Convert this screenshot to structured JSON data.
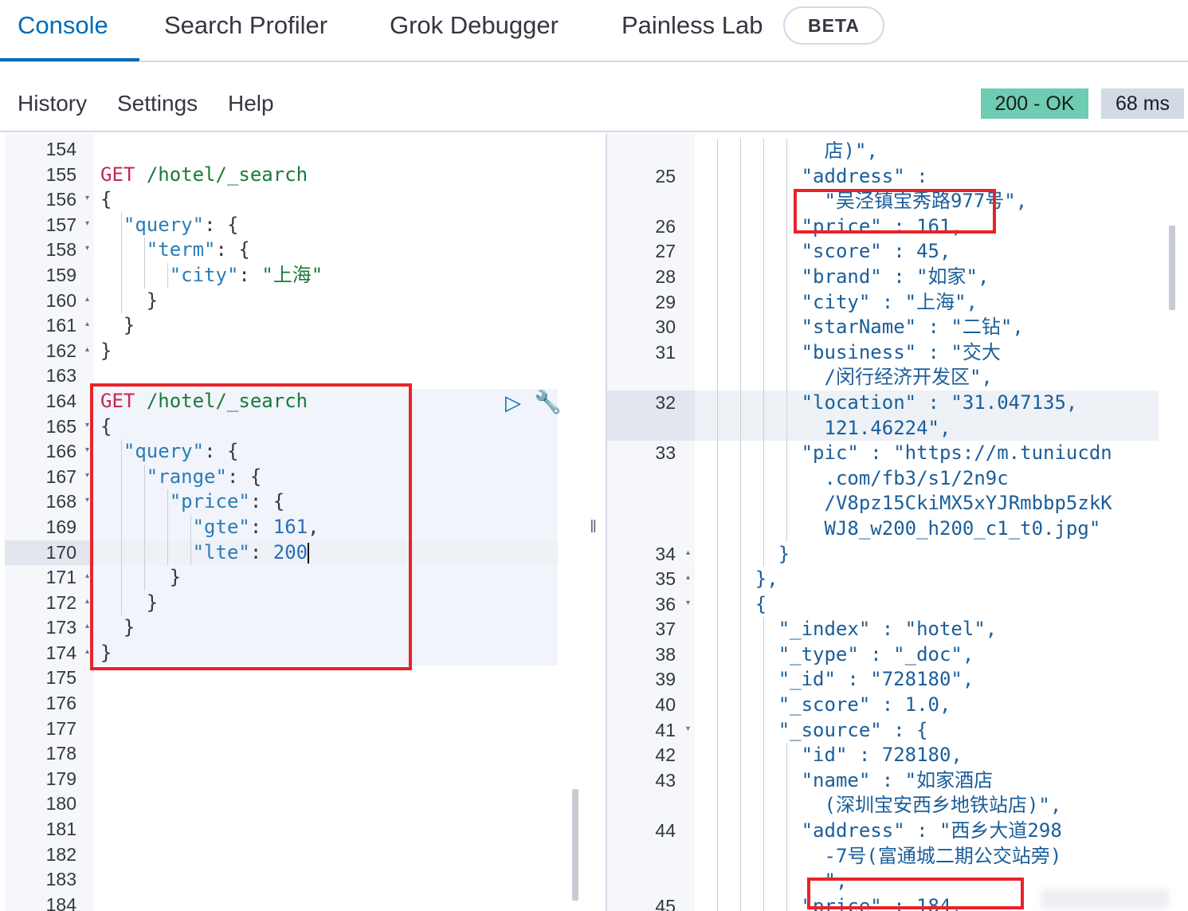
{
  "tabs": [
    {
      "label": "Console",
      "active": true
    },
    {
      "label": "Search Profiler",
      "active": false
    },
    {
      "label": "Grok Debugger",
      "active": false
    },
    {
      "label": "Painless Lab",
      "active": false
    }
  ],
  "beta_badge": "BETA",
  "toolbar": {
    "history": "History",
    "settings": "Settings",
    "help": "Help",
    "status": "200 - OK",
    "time": "68 ms"
  },
  "colors": {
    "accent": "#006bb8",
    "status_ok": "#6dccb1",
    "highlight": "#e8232a"
  },
  "editor": {
    "lines": [
      {
        "n": "154",
        "fold": "",
        "code": []
      },
      {
        "n": "155",
        "fold": "",
        "code": [
          [
            "m",
            "GET"
          ],
          [
            "p",
            " "
          ],
          [
            "u",
            "/hotel/_search"
          ]
        ]
      },
      {
        "n": "156",
        "fold": "▾",
        "code": [
          [
            "p",
            "{"
          ]
        ]
      },
      {
        "n": "157",
        "fold": "▾",
        "code": [
          [
            "p",
            "  "
          ],
          [
            "k",
            "\"query\""
          ],
          [
            "p",
            ": {"
          ]
        ]
      },
      {
        "n": "158",
        "fold": "▾",
        "code": [
          [
            "p",
            "    "
          ],
          [
            "k",
            "\"term\""
          ],
          [
            "p",
            ": {"
          ]
        ]
      },
      {
        "n": "159",
        "fold": "",
        "code": [
          [
            "p",
            "      "
          ],
          [
            "k",
            "\"city\""
          ],
          [
            "p",
            ": "
          ],
          [
            "v",
            "\"上海\""
          ]
        ]
      },
      {
        "n": "160",
        "fold": "▴",
        "code": [
          [
            "p",
            "    }"
          ]
        ]
      },
      {
        "n": "161",
        "fold": "▴",
        "code": [
          [
            "p",
            "  }"
          ]
        ]
      },
      {
        "n": "162",
        "fold": "▴",
        "code": [
          [
            "p",
            "}"
          ]
        ]
      },
      {
        "n": "163",
        "fold": "",
        "code": []
      },
      {
        "n": "164",
        "fold": "",
        "code": [
          [
            "m",
            "GET"
          ],
          [
            "p",
            " "
          ],
          [
            "u",
            "/hotel/_search"
          ]
        ]
      },
      {
        "n": "165",
        "fold": "▾",
        "code": [
          [
            "p",
            "{"
          ]
        ]
      },
      {
        "n": "166",
        "fold": "▾",
        "code": [
          [
            "p",
            "  "
          ],
          [
            "k",
            "\"query\""
          ],
          [
            "p",
            ": {"
          ]
        ]
      },
      {
        "n": "167",
        "fold": "▾",
        "code": [
          [
            "p",
            "    "
          ],
          [
            "k",
            "\"range\""
          ],
          [
            "p",
            ": {"
          ]
        ]
      },
      {
        "n": "168",
        "fold": "▾",
        "code": [
          [
            "p",
            "      "
          ],
          [
            "k",
            "\"price\""
          ],
          [
            "p",
            ": {"
          ]
        ]
      },
      {
        "n": "169",
        "fold": "",
        "code": [
          [
            "p",
            "        "
          ],
          [
            "k",
            "\"gte\""
          ],
          [
            "p",
            ": "
          ],
          [
            "n",
            "161"
          ],
          [
            "p",
            ","
          ]
        ]
      },
      {
        "n": "170",
        "fold": "",
        "code": [
          [
            "p",
            "        "
          ],
          [
            "k",
            "\"lte\""
          ],
          [
            "p",
            ": "
          ],
          [
            "n",
            "200"
          ]
        ]
      },
      {
        "n": "171",
        "fold": "▴",
        "code": [
          [
            "p",
            "      }"
          ]
        ]
      },
      {
        "n": "172",
        "fold": "▴",
        "code": [
          [
            "p",
            "    }"
          ]
        ]
      },
      {
        "n": "173",
        "fold": "▴",
        "code": [
          [
            "p",
            "  }"
          ]
        ]
      },
      {
        "n": "174",
        "fold": "▴",
        "code": [
          [
            "p",
            "}"
          ]
        ]
      },
      {
        "n": "175",
        "fold": "",
        "code": []
      },
      {
        "n": "176",
        "fold": "",
        "code": []
      },
      {
        "n": "177",
        "fold": "",
        "code": []
      },
      {
        "n": "178",
        "fold": "",
        "code": []
      },
      {
        "n": "179",
        "fold": "",
        "code": []
      },
      {
        "n": "180",
        "fold": "",
        "code": []
      },
      {
        "n": "181",
        "fold": "",
        "code": []
      },
      {
        "n": "182",
        "fold": "",
        "code": []
      },
      {
        "n": "183",
        "fold": "",
        "code": []
      },
      {
        "n": "184",
        "fold": "",
        "code": []
      }
    ],
    "active_line": "170"
  },
  "response": {
    "rows": [
      {
        "n": "",
        "fold": "",
        "indent": 6,
        "text": "店)\","
      },
      {
        "n": "25",
        "fold": "",
        "indent": 5,
        "text": "\"address\" :"
      },
      {
        "n": "",
        "fold": "",
        "indent": 6,
        "text": "\"吴泾镇宝秀路977号\","
      },
      {
        "n": "26",
        "fold": "",
        "indent": 5,
        "text": "\"price\" : 161,"
      },
      {
        "n": "27",
        "fold": "",
        "indent": 5,
        "text": "\"score\" : 45,"
      },
      {
        "n": "28",
        "fold": "",
        "indent": 5,
        "text": "\"brand\" : \"如家\","
      },
      {
        "n": "29",
        "fold": "",
        "indent": 5,
        "text": "\"city\" : \"上海\","
      },
      {
        "n": "30",
        "fold": "",
        "indent": 5,
        "text": "\"starName\" : \"二钻\","
      },
      {
        "n": "31",
        "fold": "",
        "indent": 5,
        "text": "\"business\" : \"交大"
      },
      {
        "n": "",
        "fold": "",
        "indent": 6,
        "text": "/闵行经济开发区\","
      },
      {
        "n": "32",
        "fold": "",
        "indent": 5,
        "text": "\"location\" : \"31.047135,"
      },
      {
        "n": "",
        "fold": "",
        "indent": 6,
        "text": "121.46224\","
      },
      {
        "n": "33",
        "fold": "",
        "indent": 5,
        "text": "\"pic\" : \"https://m.tuniucdn"
      },
      {
        "n": "",
        "fold": "",
        "indent": 6,
        "text": ".com/fb3/s1/2n9c"
      },
      {
        "n": "",
        "fold": "",
        "indent": 6,
        "text": "/V8pz15CkiMX5xYJRmbbp5zkK"
      },
      {
        "n": "",
        "fold": "",
        "indent": 6,
        "text": "WJ8_w200_h200_c1_t0.jpg\""
      },
      {
        "n": "34",
        "fold": "▴",
        "indent": 4,
        "text": "}"
      },
      {
        "n": "35",
        "fold": "▴",
        "indent": 3,
        "text": "},"
      },
      {
        "n": "36",
        "fold": "▾",
        "indent": 3,
        "text": "{"
      },
      {
        "n": "37",
        "fold": "",
        "indent": 4,
        "text": "\"_index\" : \"hotel\","
      },
      {
        "n": "38",
        "fold": "",
        "indent": 4,
        "text": "\"_type\" : \"_doc\","
      },
      {
        "n": "39",
        "fold": "",
        "indent": 4,
        "text": "\"_id\" : \"728180\","
      },
      {
        "n": "40",
        "fold": "",
        "indent": 4,
        "text": "\"_score\" : 1.0,"
      },
      {
        "n": "41",
        "fold": "▾",
        "indent": 4,
        "text": "\"_source\" : {"
      },
      {
        "n": "42",
        "fold": "",
        "indent": 5,
        "text": "\"id\" : 728180,"
      },
      {
        "n": "43",
        "fold": "",
        "indent": 5,
        "text": "\"name\" : \"如家酒店"
      },
      {
        "n": "",
        "fold": "",
        "indent": 6,
        "text": "(深圳宝安西乡地铁站店)\","
      },
      {
        "n": "44",
        "fold": "",
        "indent": 5,
        "text": "\"address\" : \"西乡大道298"
      },
      {
        "n": "",
        "fold": "",
        "indent": 6,
        "text": "-7号(富通城二期公交站旁)"
      },
      {
        "n": "",
        "fold": "",
        "indent": 6,
        "text": "\","
      },
      {
        "n": "45",
        "fold": "",
        "indent": 5,
        "text": "\"price\" : 184,"
      }
    ],
    "active_line": "32"
  }
}
